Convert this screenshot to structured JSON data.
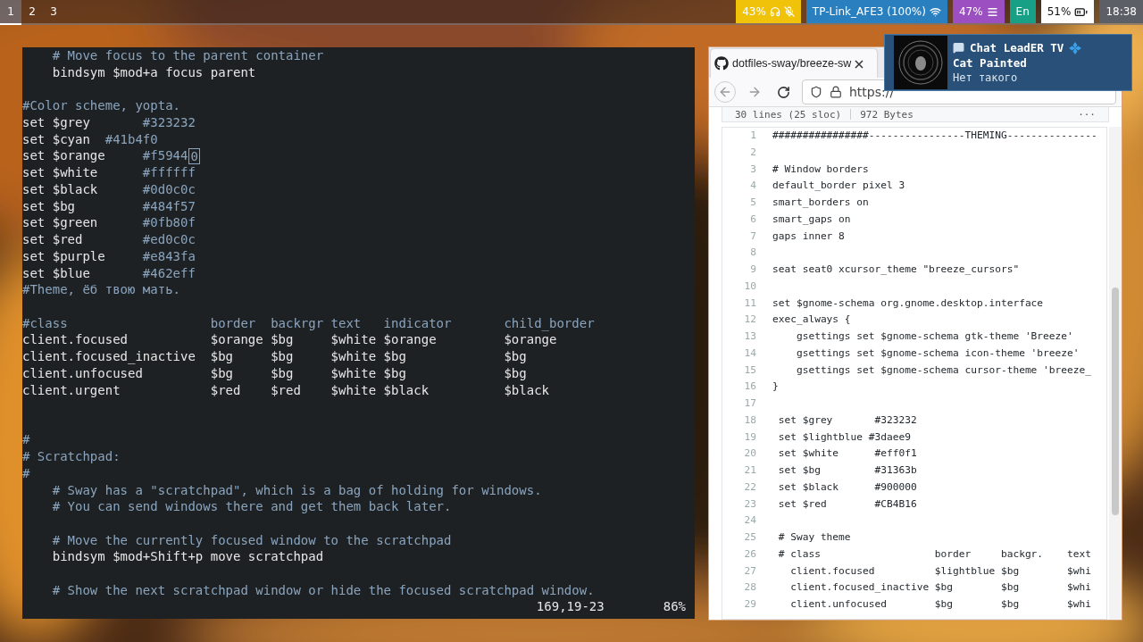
{
  "topbar": {
    "workspaces": [
      {
        "label": "1",
        "selected": true
      },
      {
        "label": "2",
        "selected": false
      },
      {
        "label": "3",
        "selected": false
      }
    ],
    "blocks": [
      {
        "kind": "audio",
        "text": "43%",
        "color": "#f0c20a"
      },
      {
        "kind": "wifi",
        "text": "TP-Link_AFE3 (100%)",
        "color": "#2a7fbf"
      },
      {
        "kind": "memory",
        "text": "47%",
        "color": "#9b4fc0"
      },
      {
        "kind": "lang",
        "text": "En",
        "color": "#17a085"
      },
      {
        "kind": "battery",
        "text": "51%",
        "color": "#ffffff"
      },
      {
        "kind": "clock",
        "text": "18:38",
        "color": "#5c6066"
      }
    ]
  },
  "terminal": {
    "lines": [
      {
        "kind": "text",
        "comment": "    # Move focus to the parent container"
      },
      {
        "kind": "text",
        "code": "    bindsym $mod+a focus parent"
      },
      {
        "kind": "blank"
      },
      {
        "kind": "text",
        "comment": "#Color scheme, yopta."
      },
      {
        "kind": "text",
        "code": "set $grey       ",
        "comment": "#323232"
      },
      {
        "kind": "text",
        "code": "set $cyan  ",
        "comment": "#41b4f0"
      },
      {
        "kind": "text",
        "code": "set $orange     ",
        "comment": "#f5944",
        "cursor": "0"
      },
      {
        "kind": "text",
        "code": "set $white      ",
        "comment": "#ffffff"
      },
      {
        "kind": "text",
        "code": "set $black      ",
        "comment": "#0d0c0c"
      },
      {
        "kind": "text",
        "code": "set $bg         ",
        "comment": "#484f57"
      },
      {
        "kind": "text",
        "code": "set $green      ",
        "comment": "#0fb80f"
      },
      {
        "kind": "text",
        "code": "set $red        ",
        "comment": "#ed0c0c"
      },
      {
        "kind": "text",
        "code": "set $purple     ",
        "comment": "#e843fa"
      },
      {
        "kind": "text",
        "code": "set $blue       ",
        "comment": "#462eff"
      },
      {
        "kind": "text",
        "comment": "#Theme, ёб твою мать."
      },
      {
        "kind": "blank"
      },
      {
        "kind": "text",
        "comment": "#class                   border  backrgr text   indicator       child_border"
      },
      {
        "kind": "text",
        "code": "client.focused           $orange $bg     $white $orange         $orange"
      },
      {
        "kind": "text",
        "code": "client.focused_inactive  $bg     $bg     $white $bg             $bg"
      },
      {
        "kind": "text",
        "code": "client.unfocused         $bg     $bg     $white $bg             $bg"
      },
      {
        "kind": "text",
        "code": "client.urgent            $red    $red    $white $black          $black"
      },
      {
        "kind": "blank"
      },
      {
        "kind": "blank"
      },
      {
        "kind": "text",
        "comment": "#"
      },
      {
        "kind": "text",
        "comment": "# Scratchpad:"
      },
      {
        "kind": "text",
        "comment": "#"
      },
      {
        "kind": "text",
        "comment": "    # Sway has a \"scratchpad\", which is a bag of holding for windows."
      },
      {
        "kind": "text",
        "comment": "    # You can send windows there and get them back later."
      },
      {
        "kind": "blank"
      },
      {
        "kind": "text",
        "comment": "    # Move the currently focused window to the scratchpad"
      },
      {
        "kind": "text",
        "code": "    bindsym $mod+Shift+p move scratchpad"
      },
      {
        "kind": "blank"
      },
      {
        "kind": "text",
        "comment": "    # Show the next scratchpad window or hide the focused scratchpad window."
      }
    ],
    "status": {
      "position": "169,19-23",
      "percent": "86%"
    }
  },
  "browser": {
    "tab": {
      "title": "dotfiles-sway/breeze-sw"
    },
    "url": "https://",
    "file_info": {
      "lines": "30 lines (25 sloc)",
      "size": "972 Bytes",
      "more": "···"
    },
    "code": [
      {
        "number": "1",
        "text": "################----------------THEMING---------------"
      },
      {
        "number": "2"
      },
      {
        "number": "3",
        "text": "# Window borders"
      },
      {
        "number": "4",
        "text": "default_border pixel 3"
      },
      {
        "number": "5",
        "text": "smart_borders on"
      },
      {
        "number": "6",
        "text": "smart_gaps on"
      },
      {
        "number": "7",
        "text": "gaps inner 8"
      },
      {
        "number": "8"
      },
      {
        "number": "9",
        "text": "seat seat0 xcursor_theme \"breeze_cursors\""
      },
      {
        "number": "10"
      },
      {
        "number": "11",
        "text": "set $gnome-schema org.gnome.desktop.interface"
      },
      {
        "number": "12",
        "text": "exec_always {"
      },
      {
        "number": "13",
        "text": "    gsettings set $gnome-schema gtk-theme 'Breeze'"
      },
      {
        "number": "14",
        "text": "    gsettings set $gnome-schema icon-theme 'breeze'"
      },
      {
        "number": "15",
        "text": "    gsettings set $gnome-schema cursor-theme 'breeze_"
      },
      {
        "number": "16",
        "text": "}"
      },
      {
        "number": "17"
      },
      {
        "number": "18",
        "text": " set $grey       #323232"
      },
      {
        "number": "19",
        "text": " set $lightblue #3daee9"
      },
      {
        "number": "20",
        "text": " set $white      #eff0f1"
      },
      {
        "number": "21",
        "text": " set $bg         #31363b"
      },
      {
        "number": "22",
        "text": " set $black      #900000"
      },
      {
        "number": "23",
        "text": " set $red        #CB4B16"
      },
      {
        "number": "24"
      },
      {
        "number": "25",
        "text": " # Sway theme"
      },
      {
        "number": "26",
        "text": " # class                   border     backgr.    text"
      },
      {
        "number": "27",
        "text": "   client.focused          $lightblue $bg        $whi"
      },
      {
        "number": "28",
        "text": "   client.focused_inactive $bg        $bg        $whi"
      },
      {
        "number": "29",
        "text": "   client.unfocused        $bg        $bg        $whi"
      }
    ]
  },
  "notification": {
    "app": "Chat LeadER TV",
    "title": "Cat Painted",
    "body": "Нет такого"
  }
}
